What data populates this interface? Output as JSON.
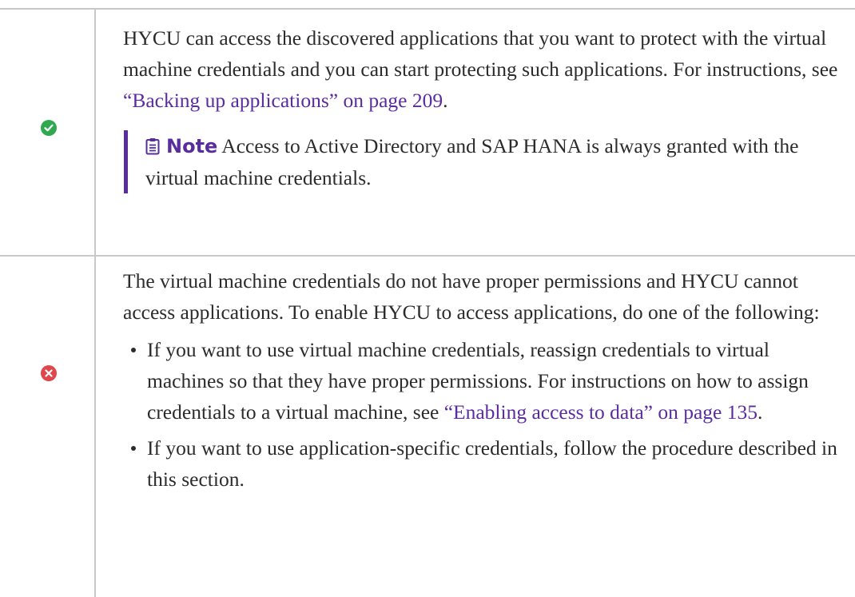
{
  "rows": [
    {
      "status": "success",
      "icon": "check-circle-icon",
      "color": "#2fa84f",
      "text_before_link": "HYCU can access the discovered applications that you want to protect with the virtual machine credentials and you can start protecting such applications. For instructions, see ",
      "link_text": "“Backing up applications” on page 209",
      "text_after_link": ".",
      "note": {
        "label": "Note",
        "icon": "clipboard-icon",
        "text": "Access to Active Directory and SAP HANA is always granted with the virtual machine credentials."
      }
    },
    {
      "status": "error",
      "icon": "x-circle-icon",
      "color": "#e0474c",
      "intro": "The virtual machine credentials do not have proper permissions and HYCU cannot access applications. To enable HYCU to access applications, do one of the following:",
      "bullets": [
        {
          "text_before_link": "If you want to use virtual machine credentials, reassign credentials to virtual machines so that they have proper permissions. For instructions on how to assign credentials to a virtual machine, see ",
          "link_text": "“Enabling access to data” on page 135",
          "text_after_link": "."
        },
        {
          "text": "If you want to use application-specific credentials, follow the procedure described in this section."
        }
      ]
    }
  ],
  "colors": {
    "link": "#5b2ca0",
    "note_accent": "#5a2d9c",
    "rule": "#c8c8c8",
    "text": "#2b2b2b"
  }
}
